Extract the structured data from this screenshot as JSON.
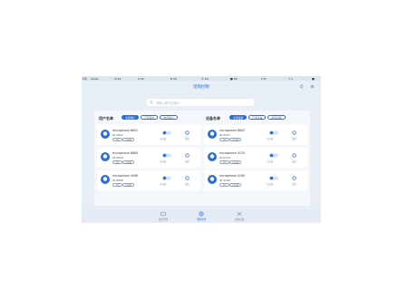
{
  "statusbar": {
    "items": [
      "F卯",
      "Glider",
      "M 59",
      "S 59",
      "B 59",
      "% 59",
      "■ 86",
      "5 M",
      "7 V",
      "...",
      "■"
    ]
  },
  "header": {
    "title": "话筒控制",
    "refresh_icon": "refresh-icon",
    "settings_icon": "gear-icon"
  },
  "search": {
    "placeholder": "请输入用户名或ID"
  },
  "user_column": {
    "title": "用户名单",
    "filters": [
      {
        "label": "全部用户",
        "active": true
      },
      {
        "label": "已连用户",
        "active": false
      },
      {
        "label": "未连用户",
        "active": false
      }
    ],
    "items": [
      {
        "name": "microphone 8601",
        "id": "ID:0602",
        "tags": [
          "主持",
          "已连接"
        ],
        "status": "已连接",
        "setting": "设置"
      },
      {
        "name": "microphone 8664",
        "id": "ID:0604",
        "tags": [
          "主持",
          "已连接"
        ],
        "status": "已连接",
        "setting": "设置"
      },
      {
        "name": "microphone 4098",
        "id": "ID:0698",
        "tags": [
          "主持",
          "已连接"
        ],
        "status": "已连接",
        "setting": "设置"
      }
    ]
  },
  "device_column": {
    "title": "设备名单",
    "filters": [
      {
        "label": "全部设备",
        "active": true
      },
      {
        "label": "已连设备",
        "active": false
      },
      {
        "label": "未连设备",
        "active": false
      }
    ],
    "items": [
      {
        "name": "microphone 8603",
        "id": "ID:0303",
        "tags": [
          "主持",
          "已连接"
        ],
        "status": "已连接",
        "setting": "设置"
      },
      {
        "name": "microphone 9115",
        "id": "ID:0115",
        "tags": [
          "主持",
          "已连接"
        ],
        "status": "已连接",
        "setting": "设置"
      },
      {
        "name": "microphone 4190",
        "id": "ID:4190",
        "tags": [
          "主持",
          "已连接"
        ],
        "status": "已连接",
        "setting": "设置"
      }
    ]
  },
  "tabbar": {
    "tabs": [
      {
        "label": "会议管理",
        "active": false
      },
      {
        "label": "话筒控制",
        "active": true
      },
      {
        "label": "系统设置",
        "active": false
      }
    ]
  },
  "colors": {
    "accent": "#2b6ed6",
    "background": "#e8eef6",
    "card": "#ffffff"
  }
}
